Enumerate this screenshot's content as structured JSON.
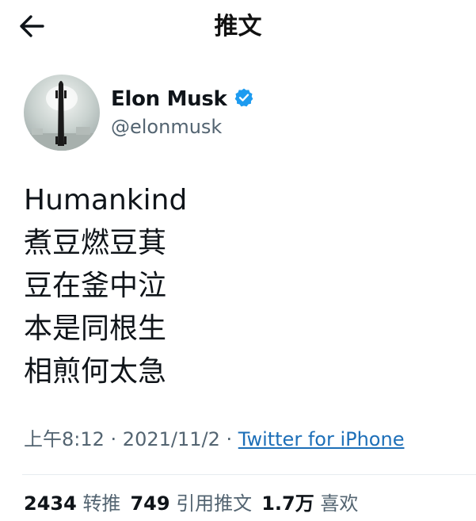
{
  "header": {
    "back_icon": "arrow-left-icon",
    "title": "推文"
  },
  "author": {
    "name": "Elon Musk",
    "handle": "@elonmusk",
    "verified_icon": "verified-badge-icon",
    "verified_color": "#1d9bf0"
  },
  "tweet": {
    "lines": [
      "Humankind",
      "煮豆燃豆萁",
      "豆在釜中泣",
      "本是同根生",
      "相煎何太急"
    ]
  },
  "meta": {
    "time": "上午8:12",
    "separator": " · ",
    "date": "2021/11/2",
    "source": "Twitter for iPhone"
  },
  "stats": {
    "retweets_count": "2434",
    "retweets_label": "转推",
    "quotes_count": "749",
    "quotes_label": "引用推文",
    "likes_count": "1.7万",
    "likes_label": "喜欢"
  }
}
